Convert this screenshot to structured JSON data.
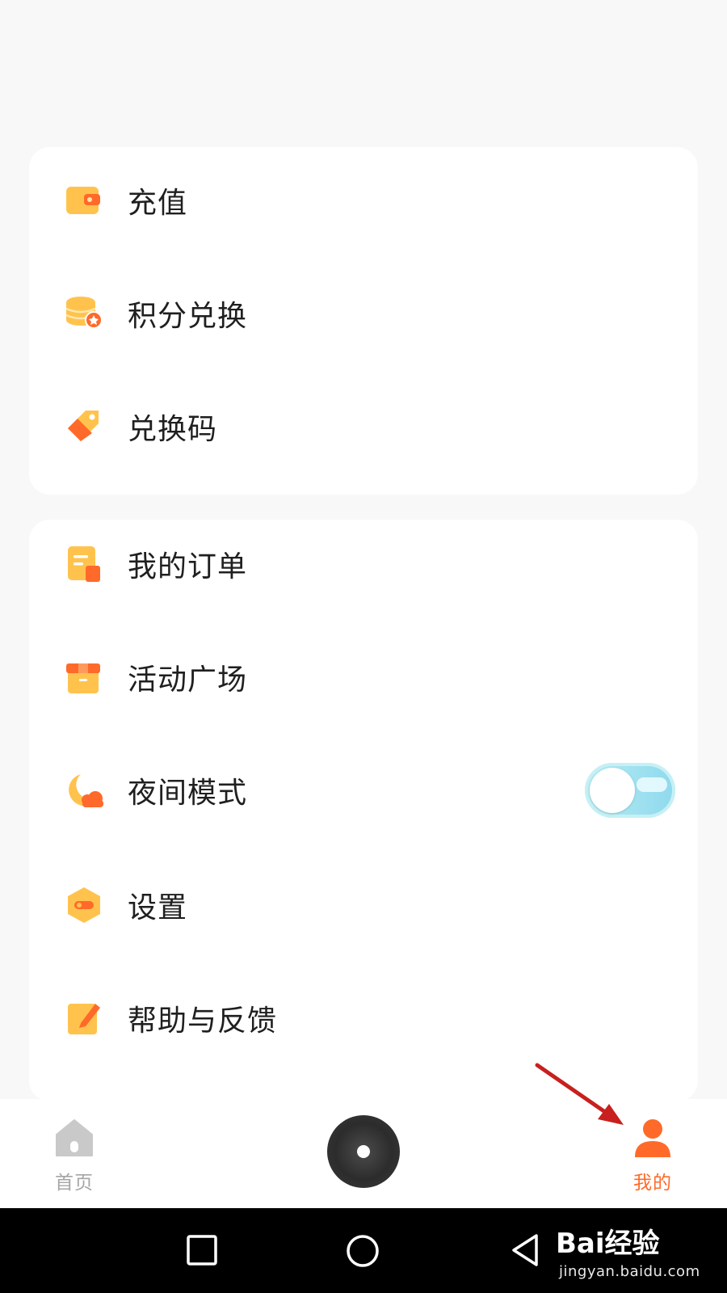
{
  "menu_group_1": [
    {
      "label": "充值",
      "icon": "wallet-icon"
    },
    {
      "label": "积分兑换",
      "icon": "coins-icon"
    },
    {
      "label": "兑换码",
      "icon": "tag-icon"
    }
  ],
  "menu_group_2": [
    {
      "label": "我的订单",
      "icon": "order-icon"
    },
    {
      "label": "活动广场",
      "icon": "gift-icon"
    },
    {
      "label": "夜间模式",
      "icon": "moon-icon",
      "toggle_on": false
    },
    {
      "label": "设置",
      "icon": "settings-icon"
    },
    {
      "label": "帮助与反馈",
      "icon": "feedback-icon"
    }
  ],
  "bottom_nav": {
    "home_label": "首页",
    "mine_label": "我的",
    "active": "mine"
  },
  "watermark": {
    "brand": "Bai经验",
    "url": "jingyan.baidu.com"
  },
  "colors": {
    "accent": "#ff6a2a",
    "icon_yellow": "#ffc34d",
    "icon_orange": "#ff6a2a",
    "inactive": "#a6a6a6",
    "toggle": "#a8e4f0"
  }
}
